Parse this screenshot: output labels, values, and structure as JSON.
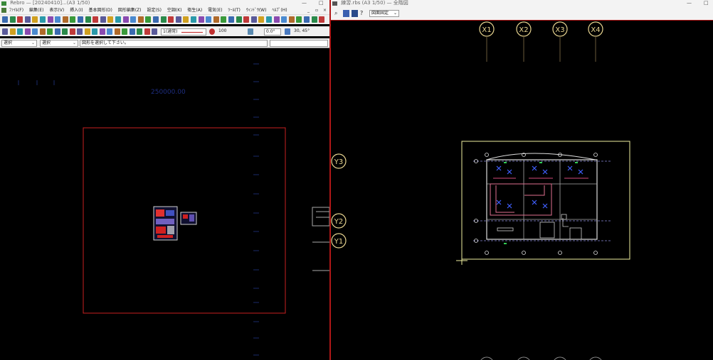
{
  "left_window": {
    "title": "Rebro — [20240410]...(A3 1/50)",
    "menus": [
      "ﾌｧｲﾙ(F)",
      "編集(E)",
      "表示(V)",
      "挿入(I)",
      "基本図形(D)",
      "図形編集(Z)",
      "設定(S)",
      "空調(K)",
      "衛生(A)",
      "電気(E)",
      "ﾂｰﾙ(T)",
      "ｳｨﾝﾄﾞｳ(W)",
      "ﾍﾙﾌﾟ(H)"
    ],
    "layer_value": "1(通常)",
    "scale_value": "100",
    "angle_value": "0.0°",
    "snap_value": "30, 45°",
    "select_mode": "選択",
    "select_filter": "選択",
    "status_hint": "図形を選択して下さい。",
    "canvas_label": "250000.00"
  },
  "right_window": {
    "title": "練習.rbs (A3 1/50) — 全階図",
    "view_mode": "図面固定",
    "grid_labels_top": [
      "X1",
      "X2",
      "X3",
      "X4"
    ],
    "grid_labels_left": [
      "Y3",
      "Y2",
      "Y1"
    ]
  },
  "colors": {
    "divider": "#b01818",
    "grid_bubble": "#e8d590",
    "sheet_border_left": "#c82020",
    "sheet_border_right": "#f0f0a0"
  }
}
